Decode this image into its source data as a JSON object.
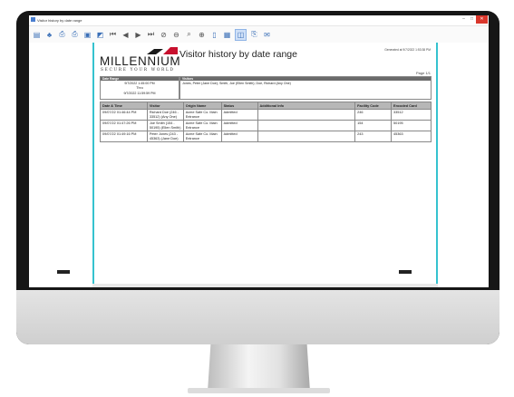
{
  "window": {
    "title": "Visitor history by date range",
    "controls": [
      "–",
      "□",
      "✕"
    ]
  },
  "toolbar": {
    "items": [
      {
        "name": "save-icon",
        "glyph": "▤"
      },
      {
        "name": "binoculars-icon",
        "glyph": "♣"
      },
      {
        "name": "print-icon",
        "glyph": "⎙"
      },
      {
        "name": "quick-print-icon",
        "glyph": "⎙"
      },
      {
        "name": "page-setup-icon",
        "glyph": "▣"
      },
      {
        "name": "scale-icon",
        "glyph": "◩"
      },
      {
        "name": "first-page-icon",
        "glyph": "⏮"
      },
      {
        "name": "prev-page-icon",
        "glyph": "◀"
      },
      {
        "name": "next-page-icon",
        "glyph": "▶"
      },
      {
        "name": "last-page-icon",
        "glyph": "⏭"
      },
      {
        "name": "hand-icon",
        "glyph": "⊘"
      },
      {
        "name": "zoom-out-icon",
        "glyph": "⊖"
      },
      {
        "name": "zoom-dropdown-icon",
        "glyph": "⌕"
      },
      {
        "name": "zoom-in-icon",
        "glyph": "⊕"
      },
      {
        "name": "single-page-icon",
        "glyph": "▯"
      },
      {
        "name": "multi-page-icon",
        "glyph": "▦"
      },
      {
        "name": "background-icon",
        "glyph": "◫"
      },
      {
        "name": "export-icon",
        "glyph": "⎘"
      },
      {
        "name": "email-icon",
        "glyph": "✉"
      }
    ]
  },
  "report": {
    "logo_word": "MILLENNIUM",
    "logo_tag": "SECURE YOUR WORLD",
    "title": "Visitor history by date range",
    "generated": "Generated at 9/7/2022 1:53:38 PM",
    "page": "Page 1/1",
    "header": {
      "left_label": "Date Range",
      "date_from": "9/7/2022 1:45:00 PM",
      "to": "Thru",
      "date_to": "9/7/2022 11:59:59 PM",
      "right_label": "Visitors",
      "visitors": "Jones, Peter (Jane Doe); Smith, Joe (Ellen Smith); Doe, Richard (Any One)"
    },
    "columns": [
      "Date & Time",
      "Visitor",
      "Origin Name",
      "Status",
      "Additional Info",
      "Facility Code",
      "Encoded Card"
    ],
    "rows": [
      [
        "09/07/22 01:46:44 PM",
        "Richard Doe (246 - 33512) (Any One)",
        "Acme Safe Co. Main Entrance",
        "Admitted",
        "",
        "246",
        "33512"
      ],
      [
        "09/07/22 01:47:26 PM",
        "Joe Smith (154 - 50195) (Ellen Smith)",
        "Acme Safe Co. Main Entrance",
        "Admitted",
        "",
        "154",
        "50195"
      ],
      [
        "09/07/22 01:49:16 PM",
        "Peter Jones (243 - 45363) (Jane Doe)",
        "Acme Safe Co. Main Entrance",
        "Admitted",
        "",
        "243",
        "45363"
      ]
    ]
  },
  "colors": {
    "accent": "#35c2cf",
    "close": "#d9362b",
    "logo_red": "#c8102e"
  }
}
